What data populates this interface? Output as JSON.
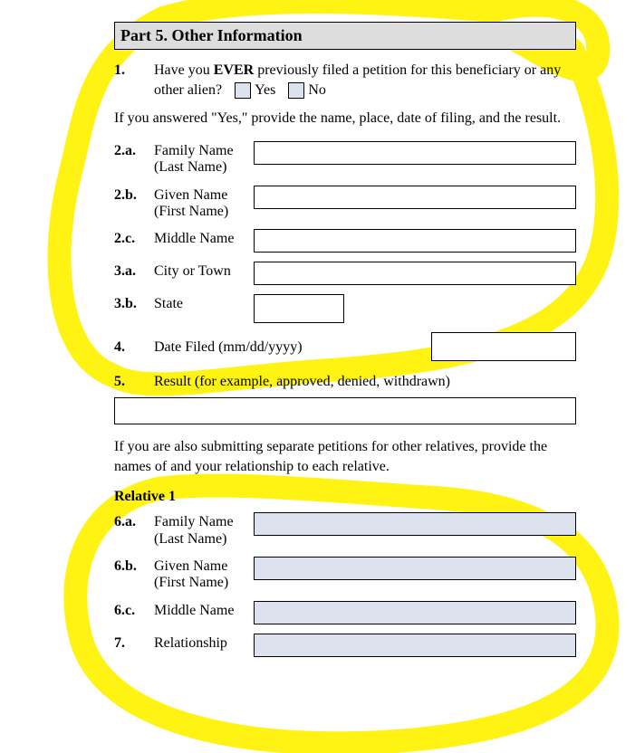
{
  "header": {
    "title": "Part 5.  Other Information"
  },
  "q1": {
    "num": "1.",
    "text_pre": "Have you ",
    "text_ever": "EVER",
    "text_post": " previously filed a petition for this beneficiary or any other alien?",
    "yes": "Yes",
    "no": "No"
  },
  "instr1": "If you answered \"Yes,\" provide the name, place, date of filing, and the result.",
  "r2a": {
    "num": "2.a.",
    "label": "Family Name",
    "label2": "(Last Name)"
  },
  "r2b": {
    "num": "2.b.",
    "label": "Given Name",
    "label2": "(First Name)"
  },
  "r2c": {
    "num": "2.c.",
    "label": "Middle Name"
  },
  "r3a": {
    "num": "3.a.",
    "label": "City or Town"
  },
  "r3b": {
    "num": "3.b.",
    "label": "State"
  },
  "r4": {
    "num": "4.",
    "label": "Date Filed (mm/dd/yyyy)"
  },
  "r5": {
    "num": "5.",
    "label": "Result (for example, approved, denied, withdrawn)"
  },
  "instr2": "If you are also submitting separate petitions for other relatives, provide the names of and your relationship to each relative.",
  "rel1_head": "Relative 1",
  "r6a": {
    "num": "6.a.",
    "label": "Family Name",
    "label2": "(Last Name)"
  },
  "r6b": {
    "num": "6.b.",
    "label": "Given Name",
    "label2": "(First Name)"
  },
  "r6c": {
    "num": "6.c.",
    "label": "Middle Name"
  },
  "r7": {
    "num": "7.",
    "label": "Relationship"
  }
}
